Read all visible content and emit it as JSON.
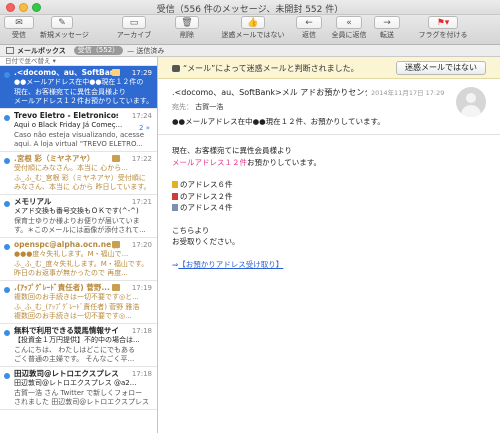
{
  "window": {
    "title": "受信（556 件のメッセージ、未開封 552 件）"
  },
  "toolbar": {
    "items": [
      {
        "label": "受信",
        "icon": "envelope-icon"
      },
      {
        "label": "新規メッセージ",
        "icon": "compose-icon"
      },
      {
        "label": "アーカイブ",
        "icon": "archive-icon"
      },
      {
        "label": "削除",
        "icon": "trash-icon"
      },
      {
        "label": "迷惑メールではない",
        "icon": "thumbs-up-icon"
      },
      {
        "label": "返信",
        "icon": "reply-icon"
      },
      {
        "label": "全員に返信",
        "icon": "reply-all-icon"
      },
      {
        "label": "転送",
        "icon": "forward-icon"
      },
      {
        "label": "フラグを付ける",
        "icon": "flag-icon"
      }
    ]
  },
  "favbar": {
    "mailboxes": "メールボックス",
    "inbox_label": "受信（552）",
    "sent_label": "送信済み"
  },
  "list": {
    "sort_label": "日付で並べ替え",
    "messages": [
      {
        "from": ".<docomo、au、SoftBan...",
        "time": "17:29",
        "line1": "●●メールアドレス在中●●現在１２件の",
        "line2": "現在、お客様宛てに異性会員様より",
        "line3": "メールアドレス１２件お預かりしています。",
        "selected": true,
        "junk": false,
        "attach": true,
        "thread": ""
      },
      {
        "from": "Trevo Eletro - Eletronicos",
        "time": "17:24",
        "line1": "Aqui o Black Friday Já Começ...",
        "line2": "Caso não esteja visualizando, acesse",
        "line3": "aqui. A loja virtual \"TREVO ELETRO...",
        "selected": false,
        "junk": false,
        "attach": false,
        "thread": "2 »"
      },
      {
        "from": ".宮根 彩（ミヤネアヤ）",
        "time": "17:22",
        "line1": "受付順にみなさん。本当に 心から...",
        "line2": "ふ_ふ_む_宮根 彩（ミヤネアヤ）受付順に",
        "line3": "みなさん、本当に 心から 昨日しています。",
        "selected": false,
        "junk": true,
        "attach": true,
        "thread": ""
      },
      {
        "from": "メモリアル",
        "time": "17:21",
        "line1": "メアド交換も番号交換もＯＫです(^-^)",
        "line2": "保育士ゆりか様よりお便りが届いていま",
        "line3": "す。＊このメールには画像が添付されて...",
        "selected": false,
        "junk": false,
        "attach": false,
        "thread": ""
      },
      {
        "from": "openspc@alpha.ocn.ne.jp",
        "time": "17:20",
        "line1": "●●●度々失礼します。M・福山で...",
        "line2": "ふ_ふ_む_度々失礼します。M・福山です。",
        "line3": "昨日のお返事が無かったので 再度...",
        "selected": false,
        "junk": true,
        "attach": true,
        "thread": ""
      },
      {
        "from": ".(ｱｯﾌﾟｸﾞﾚｰﾄﾞ責任者) 菅野...",
        "time": "17:19",
        "line1": "複数回のお手続きは一切不要です◎と...",
        "line2": "ふ_ふ_む_(ｱｯﾌﾟｸﾞﾚｰﾄﾞ責任者) 菅野 雅浩",
        "line3": "複数回のお手続きは一切不要です◎...",
        "selected": false,
        "junk": true,
        "attach": true,
        "thread": ""
      },
      {
        "from": "無料で利用できる競馬情報サイト",
        "time": "17:18",
        "line1": "【投資金１万円提供】不的中の場合は...",
        "line2": "こんにちは、 わたしはどこにでもある",
        "line3": "ごく普通の主婦です。 そんなごく平...",
        "selected": false,
        "junk": false,
        "attach": false,
        "thread": ""
      },
      {
        "from": "田辺敦司@レトロエクスプレス",
        "time": "17:18",
        "line1": "田辺敦司@レトロエクスプレス @a2...",
        "line2": "古賀一浩 さん Twitter で新しくフォロー",
        "line3": "されました 田辺敦司@レトロエクスプレス",
        "selected": false,
        "junk": false,
        "attach": false,
        "thread": ""
      }
    ]
  },
  "junk_banner": {
    "text": "“メール”によって迷惑メールと判断されました。",
    "button": "迷惑メールではない"
  },
  "message": {
    "from": ".<docomo、au、SoftBank>メル アドお預かりセンター.",
    "date": "2014年11月17日 17:29",
    "to_label": "宛先：",
    "to_name": "古賀一浩",
    "subject": "●●メールアドレス在中●●現在１２件、お預かりしています。",
    "body_line1": "現在、お客様宛てに異性会員様より",
    "body_pink": "メールアドレス１２件",
    "body_line2_tail": "お預かりしています。",
    "item1": "のアドレス６件",
    "item2": "のアドレス２件",
    "item3": "のアドレス４件",
    "closing1": "こちらより",
    "closing2": "お受取りください。",
    "link_arrow": "⇒",
    "link_text": "【お預かりアドレス受け取り】"
  },
  "colors": {
    "selection": "#2f6ad0",
    "junk_banner": "#fbf5d3",
    "pink_text": "#e0348c",
    "link": "#2a5fd8",
    "junk_text": "#b8893c"
  }
}
